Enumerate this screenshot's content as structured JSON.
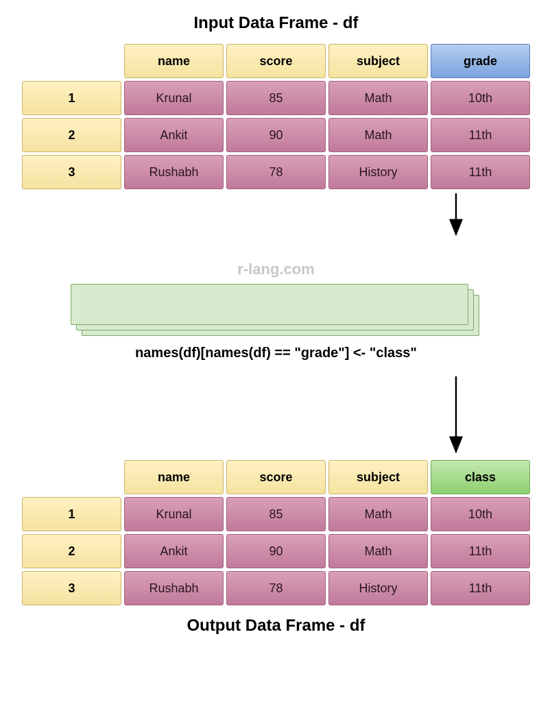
{
  "input": {
    "title": "Input Data Frame - df",
    "headers": [
      "name",
      "score",
      "subject",
      "grade"
    ],
    "highlight_header_index": 3,
    "highlight_color": "blue",
    "row_indices": [
      "1",
      "2",
      "3"
    ],
    "rows": [
      [
        "Krunal",
        "85",
        "Math",
        "10th"
      ],
      [
        "Ankit",
        "90",
        "Math",
        "11th"
      ],
      [
        "Rushabh",
        "78",
        "History",
        "11th"
      ]
    ]
  },
  "watermark": "r-lang.com",
  "code": "names(df)[names(df) == \"grade\"] <- \"class\"",
  "output": {
    "title": "Output Data Frame - df",
    "headers": [
      "name",
      "score",
      "subject",
      "class"
    ],
    "highlight_header_index": 3,
    "highlight_color": "green",
    "row_indices": [
      "1",
      "2",
      "3"
    ],
    "rows": [
      [
        "Krunal",
        "85",
        "Math",
        "10th"
      ],
      [
        "Ankit",
        "90",
        "Math",
        "11th"
      ],
      [
        "Rushabh",
        "78",
        "History",
        "11th"
      ]
    ]
  }
}
